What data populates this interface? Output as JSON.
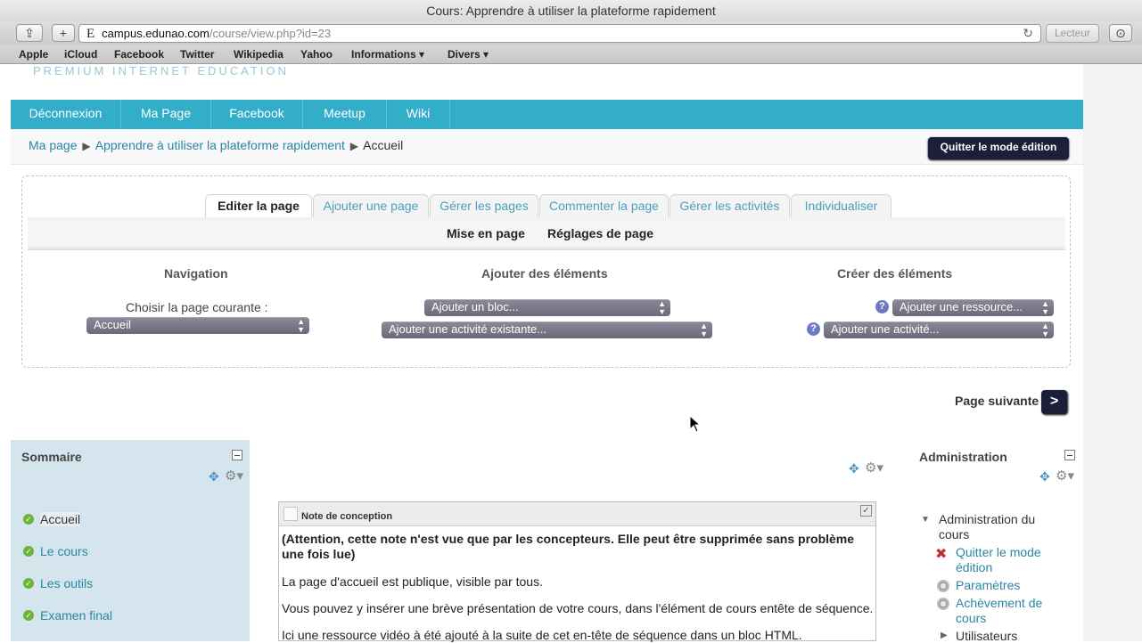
{
  "browser": {
    "window_title": "Cours: Apprendre à utiliser la plateforme rapidement",
    "url_favicon": "E",
    "url_host": "campus.edunao.com",
    "url_path": "/course/view.php?id=23",
    "reader_label": "Lecteur",
    "add_tab_symbol": "+",
    "share_symbol": "⇪",
    "reload_symbol": "↻",
    "downloads_symbol": "⊙",
    "bookmarks": [
      "Apple",
      "iCloud",
      "Facebook",
      "Twitter",
      "Wikipedia",
      "Yahoo",
      "Informations ▾",
      "Divers ▾"
    ]
  },
  "header": {
    "tagline": "PREMIUM INTERNET EDUCATION"
  },
  "navbar": {
    "items": [
      "Déconnexion",
      "Ma Page",
      "Facebook",
      "Meetup",
      "Wiki"
    ]
  },
  "breadcrumb": {
    "items": [
      "Ma page",
      "Apprendre à utiliser la plateforme rapidement",
      "Accueil"
    ],
    "separator": "▶"
  },
  "edit_mode_button": "Quitter le mode édition",
  "edit_panel": {
    "tabs": [
      "Editer la page",
      "Ajouter une page",
      "Gérer les pages",
      "Commenter la page",
      "Gérer les activités",
      "Individualiser"
    ],
    "active_tab": "Editer la page",
    "subtabs": [
      "Mise en page",
      "Réglages de page"
    ],
    "navigation": {
      "heading": "Navigation",
      "label": "Choisir la page courante :",
      "selected": "Accueil"
    },
    "add_elements": {
      "heading": "Ajouter des éléments",
      "block_select": "Ajouter un bloc...",
      "activity_select": "Ajouter une activité existante..."
    },
    "create_elements": {
      "heading": "Créer des éléments",
      "resource_select": "Ajouter une ressource...",
      "activity_select": "Ajouter une activité..."
    }
  },
  "next_page": {
    "label": "Page suivante",
    "button": ">"
  },
  "summary_block": {
    "title": "Sommaire",
    "items": [
      "Accueil",
      "Le cours",
      "Les outils",
      "Examen final"
    ]
  },
  "note_block": {
    "title": "Note de conception",
    "warning": "(Attention, cette note n'est vue que par les concepteurs. Elle peut être supprimée sans problème une fois lue)",
    "paragraphs": [
      "La page d'accueil est publique, visible par tous.",
      "Vous pouvez y insérer une brève présentation de votre cours, dans l'élément de cours entête de séquence.",
      "Ici une ressource vidéo à été ajouté à la suite de cet en-tête de séquence dans un bloc HTML."
    ]
  },
  "admin_block": {
    "title": "Administration",
    "section": "Administration du cours",
    "items": [
      "Quitter le mode édition",
      "Paramètres",
      "Achèvement de cours",
      "Utilisateurs"
    ]
  },
  "colors": {
    "nav_bg": "#33aec9",
    "dark_button": "#1c1f3a",
    "link": "#2a86a3",
    "summary_bg": "#d4e5ee"
  }
}
